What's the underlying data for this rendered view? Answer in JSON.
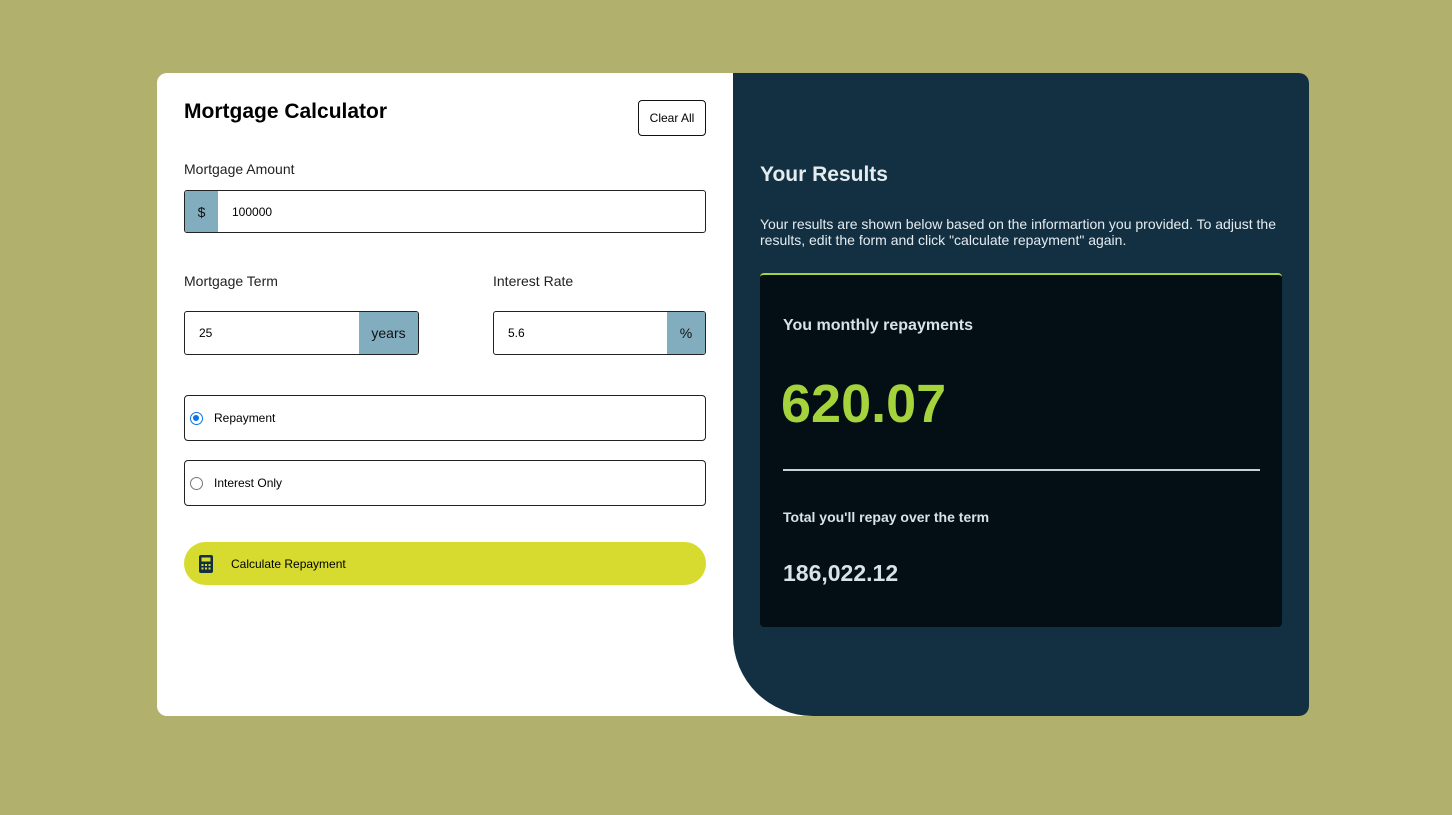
{
  "form": {
    "title": "Mortgage Calculator",
    "clear_label": "Clear All",
    "amount": {
      "label": "Mortgage Amount",
      "prefix": "$",
      "value": "100000"
    },
    "term": {
      "label": "Mortgage Term",
      "value": "25",
      "suffix": "years"
    },
    "rate": {
      "label": "Interest Rate",
      "value": "5.6",
      "suffix": "%"
    },
    "types": [
      {
        "label": "Repayment",
        "checked": true
      },
      {
        "label": "Interest Only",
        "checked": false
      }
    ],
    "calculate_label": "Calculate Repayment",
    "calculate_icon": "calculator-icon"
  },
  "results": {
    "title": "Your Results",
    "description": "Your results are shown below based on the informartion you provided. To adjust the results, edit the form and click \"calculate repayment\" again.",
    "monthly_label": "You monthly repayments",
    "monthly_value": "620.07",
    "total_label": "Total you'll repay over the term",
    "total_value": "186,022.12"
  },
  "colors": {
    "background": "#b1b16d",
    "panel": "#133042",
    "result_card": "#030f15",
    "accent_lime": "#a5d33c",
    "button_yellow": "#d8db2f",
    "addon_blue": "#82adbf"
  }
}
